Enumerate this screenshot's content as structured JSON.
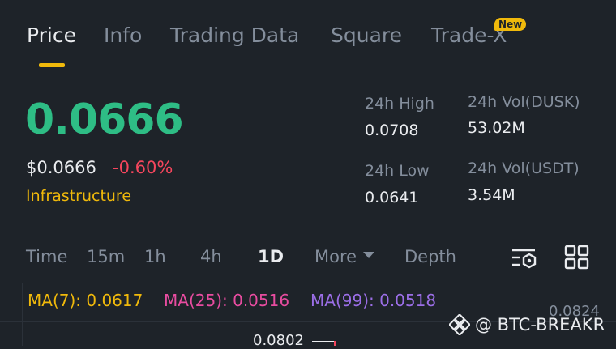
{
  "tabs": [
    {
      "label": "Price"
    },
    {
      "label": "Info"
    },
    {
      "label": "Trading Data"
    },
    {
      "label": "Square"
    },
    {
      "label": "Trade-X",
      "badge": "New"
    }
  ],
  "ticker": {
    "price": "0.0666",
    "usd_price": "$0.0666",
    "change": "-0.60%",
    "category": "Infrastructure"
  },
  "stats": {
    "high_label": "24h High",
    "high_value": "0.0708",
    "low_label": "24h Low",
    "low_value": "0.0641",
    "vol_base_label": "24h Vol(DUSK)",
    "vol_base_value": "53.02M",
    "vol_quote_label": "24h Vol(USDT)",
    "vol_quote_value": "3.54M"
  },
  "timeframes": {
    "items": [
      "Time",
      "15m",
      "1h",
      "4h",
      "1D"
    ],
    "active": "1D",
    "more_label": "More",
    "depth_label": "Depth"
  },
  "icons": {
    "settings": "chart-settings-icon",
    "layout": "grid-layout-icon",
    "watermark": "binance-logo-icon"
  },
  "moving_averages": [
    {
      "label": "MA(7): 0.0617",
      "color": "#f0b90b"
    },
    {
      "label": "MA(25): 0.0516",
      "color": "#e84ca0"
    },
    {
      "label": "MA(99): 0.0518",
      "color": "#9b6ee6"
    }
  ],
  "chart": {
    "axis_top_value": "0.0824",
    "visible_high_label": "0.0802"
  },
  "watermark": {
    "text": "@ BTC-BREAKR"
  },
  "colors": {
    "background": "#1e2329",
    "up": "#2ebd85",
    "down": "#f6465d",
    "accent": "#f0b90b",
    "muted": "#848e9c"
  }
}
